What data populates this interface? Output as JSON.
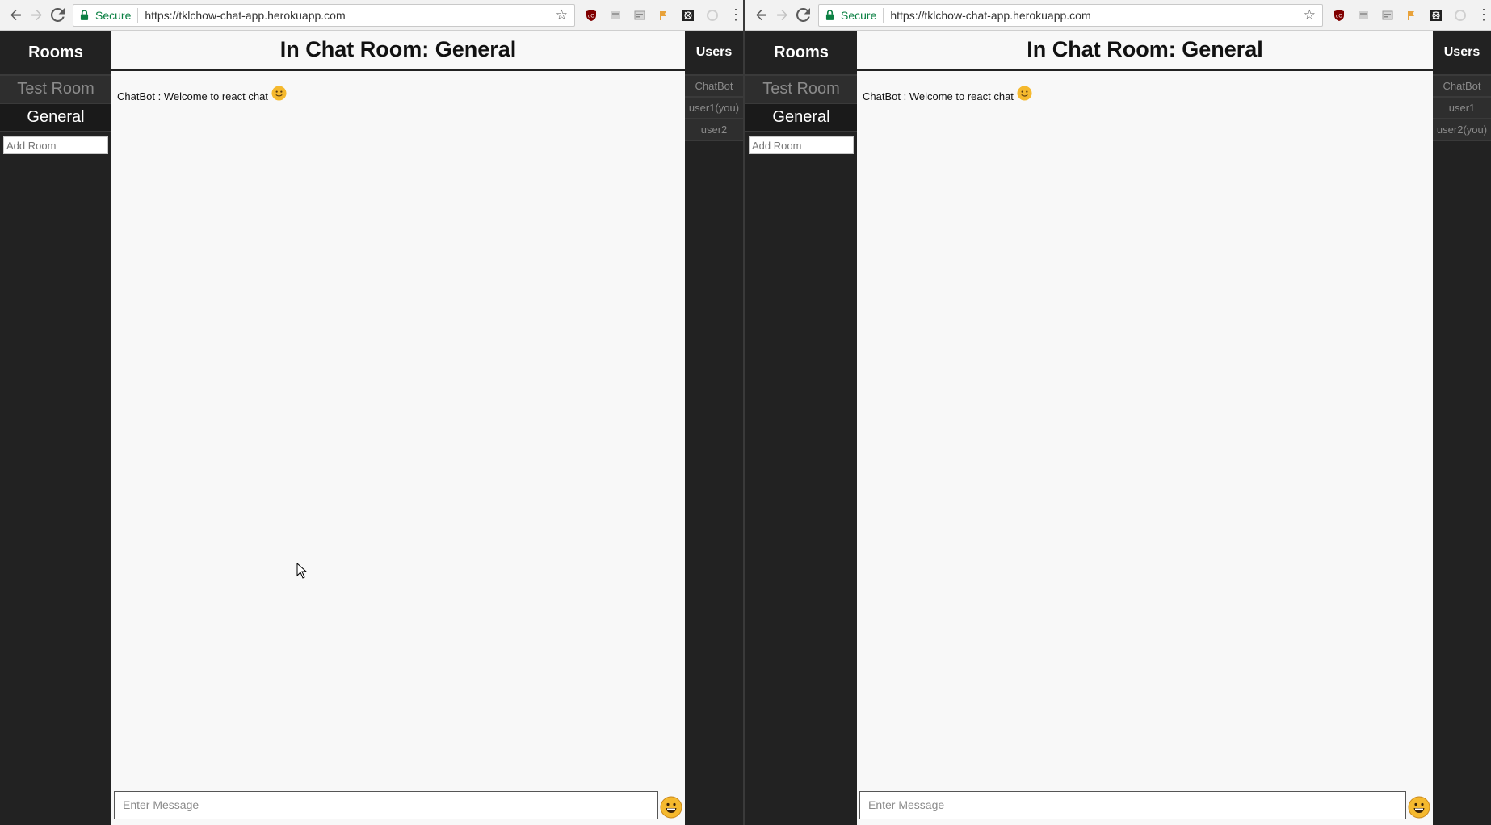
{
  "windows": [
    {
      "browser": {
        "secure_label": "Secure",
        "url": "https://tklchow-chat-app.herokuapp.com"
      },
      "rooms": {
        "title": "Rooms",
        "items": [
          {
            "label": "Test Room"
          },
          {
            "label": "General"
          }
        ],
        "add_room_placeholder": "Add Room"
      },
      "chat": {
        "title": "In Chat Room: General",
        "messages": [
          {
            "sender": "ChatBot",
            "separator": " : ",
            "text": "Welcome to react chat"
          }
        ],
        "input_placeholder": "Enter Message"
      },
      "users": {
        "title": "Users",
        "items": [
          {
            "label": "ChatBot"
          },
          {
            "label": "user1(you)"
          },
          {
            "label": "user2"
          }
        ]
      }
    },
    {
      "browser": {
        "secure_label": "Secure",
        "url": "https://tklchow-chat-app.herokuapp.com"
      },
      "rooms": {
        "title": "Rooms",
        "items": [
          {
            "label": "Test Room"
          },
          {
            "label": "General"
          }
        ],
        "add_room_placeholder": "Add Room"
      },
      "chat": {
        "title": "In Chat Room: General",
        "messages": [
          {
            "sender": "ChatBot",
            "separator": " : ",
            "text": "Welcome to react chat"
          }
        ],
        "input_placeholder": "Enter Message"
      },
      "users": {
        "title": "Users",
        "items": [
          {
            "label": "ChatBot"
          },
          {
            "label": "user1"
          },
          {
            "label": "user2(you)"
          }
        ]
      }
    }
  ],
  "colors": {
    "sidebar_bg": "#222222",
    "chat_bg": "#f8f8f8",
    "secure_green": "#0b8043",
    "emoji_yellow": "#f5b92e"
  },
  "icons": [
    "back-arrow-icon",
    "forward-arrow-icon",
    "reload-icon",
    "lock-icon",
    "star-icon",
    "ublock-icon",
    "extension-icon",
    "menu-dots-icon",
    "smiley-emoji-icon",
    "grinning-emoji-icon",
    "mouse-cursor-icon"
  ]
}
